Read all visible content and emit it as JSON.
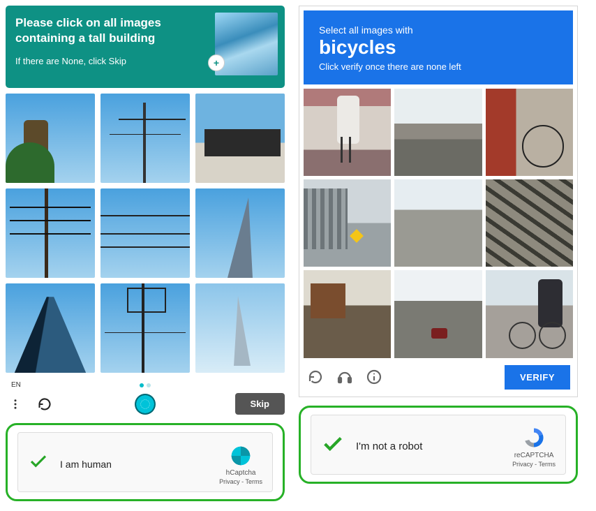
{
  "hcaptcha": {
    "header_line1": "Please click on all images containing a tall building",
    "header_line2": "If there are None, click Skip",
    "example_hint_icon": "plus-icon",
    "tiles": [
      {
        "alt": "tree with bark against sky"
      },
      {
        "alt": "power lines and utility pole"
      },
      {
        "alt": "modern flat-roof house"
      },
      {
        "alt": "electric utility pole with many wires"
      },
      {
        "alt": "transmission wires against blue sky"
      },
      {
        "alt": "tall pointed skyscraper (Burj Khalifa)"
      },
      {
        "alt": "looking up at glass skyscraper"
      },
      {
        "alt": "high-voltage pylon wires"
      },
      {
        "alt": "thin tapering tower against clouds"
      }
    ],
    "language": "EN",
    "pagination_dots": 2,
    "pagination_active": 0,
    "skip_label": "Skip"
  },
  "recaptcha": {
    "header_l1": "Select all images with",
    "header_l2": "bicycles",
    "header_l3": "Click verify once there are none left",
    "tiles": [
      {
        "alt": "person riding bicycle on paved path"
      },
      {
        "alt": "highway overpass with cars"
      },
      {
        "alt": "red container with parked bicycle beside it"
      },
      {
        "alt": "street pole near multi-story building"
      },
      {
        "alt": "parking lot and road"
      },
      {
        "alt": "striped road shadows / crosswalk area"
      },
      {
        "alt": "small roadside buildings with people"
      },
      {
        "alt": "wide road with car and traffic lights"
      },
      {
        "alt": "person with backpack on a bicycle"
      }
    ],
    "verify_label": "VERIFY"
  },
  "h_widget": {
    "text": "I am human",
    "brand": "hCaptcha",
    "privacy": "Privacy",
    "terms": "Terms"
  },
  "r_widget": {
    "text": "I'm not a robot",
    "brand": "reCAPTCHA",
    "privacy": "Privacy",
    "terms": "Terms"
  }
}
